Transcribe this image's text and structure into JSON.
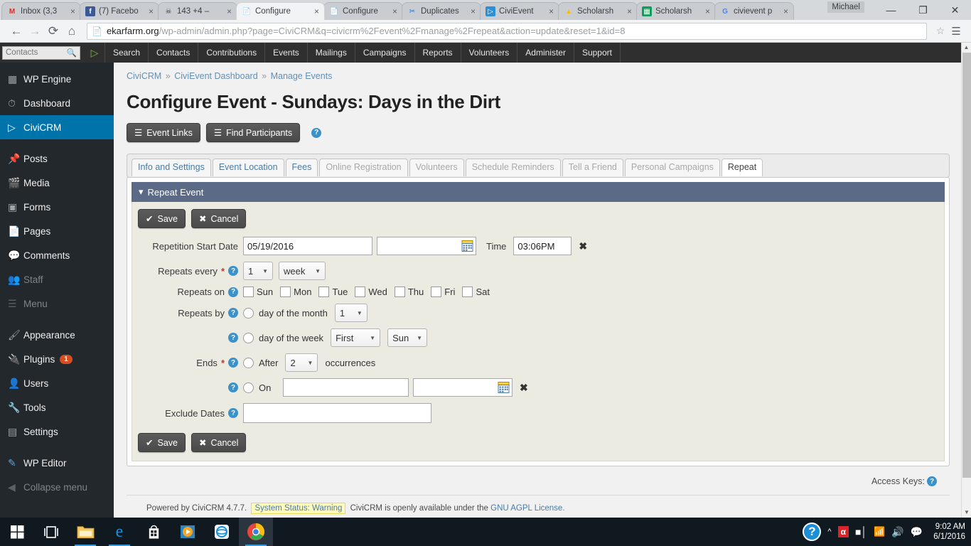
{
  "browser": {
    "tabs": [
      {
        "label": "Inbox (3,3",
        "icon": "gmail-icon",
        "active": false
      },
      {
        "label": "(7) Facebo",
        "icon": "facebook-icon",
        "active": false
      },
      {
        "label": "143 +4 –",
        "icon": "skull-icon",
        "active": false
      },
      {
        "label": "Configure",
        "icon": "page-icon",
        "active": true
      },
      {
        "label": "Configure",
        "icon": "page-icon",
        "active": false
      },
      {
        "label": "Duplicates",
        "icon": "scissors-icon",
        "active": false
      },
      {
        "label": "CiviEvent",
        "icon": "civi-icon",
        "active": false
      },
      {
        "label": "Scholarsh",
        "icon": "gdrive-icon",
        "active": false
      },
      {
        "label": "Scholarsh",
        "icon": "gsheets-icon",
        "active": false
      },
      {
        "label": "civievent p",
        "icon": "google-icon",
        "active": false
      }
    ],
    "close_glyph": "×",
    "user_chip": "Michael",
    "window_controls": {
      "minimize": "—",
      "maximize": "❐",
      "close": "✕"
    },
    "nav": {
      "back": "←",
      "forward": "→",
      "reload": "⟳",
      "home": "⌂"
    },
    "url_host": "ekarfarm.org",
    "url_path": "/wp-admin/admin.php?page=CiviCRM&q=civicrm%2Fevent%2Fmanage%2Frepeat&action=update&reset=1&id=8",
    "star": "☆",
    "menu": "☰"
  },
  "civibar": {
    "search_placeholder": "Contacts",
    "search_icon": "search-icon",
    "logo": "civicrm-logo",
    "items": [
      "Search",
      "Contacts",
      "Contributions",
      "Events",
      "Mailings",
      "Campaigns",
      "Reports",
      "Volunteers",
      "Administer",
      "Support"
    ]
  },
  "sidebar": {
    "items": [
      {
        "label": "WP Engine",
        "icon": "wpengine-icon",
        "state": "normal"
      },
      {
        "label": "Dashboard",
        "icon": "dashboard-icon",
        "state": "normal"
      },
      {
        "label": "CiviCRM",
        "icon": "civicrm-icon",
        "state": "current"
      },
      {
        "label": "Posts",
        "icon": "pin-icon",
        "state": "normal"
      },
      {
        "label": "Media",
        "icon": "media-icon",
        "state": "normal"
      },
      {
        "label": "Forms",
        "icon": "forms-icon",
        "state": "normal"
      },
      {
        "label": "Pages",
        "icon": "pages-icon",
        "state": "normal"
      },
      {
        "label": "Comments",
        "icon": "comment-icon",
        "state": "normal"
      },
      {
        "label": "Staff",
        "icon": "users-icon",
        "state": "dim"
      },
      {
        "label": "Menu",
        "icon": "menu-icon",
        "state": "dim"
      },
      {
        "label": "Appearance",
        "icon": "brush-icon",
        "state": "normal"
      },
      {
        "label": "Plugins",
        "icon": "plug-icon",
        "state": "normal",
        "badge": "1"
      },
      {
        "label": "Users",
        "icon": "user-icon",
        "state": "normal"
      },
      {
        "label": "Tools",
        "icon": "wrench-icon",
        "state": "normal"
      },
      {
        "label": "Settings",
        "icon": "sliders-icon",
        "state": "normal"
      },
      {
        "label": "WP Editor",
        "icon": "pencil-icon",
        "state": "normal"
      },
      {
        "label": "Collapse menu",
        "icon": "collapse-icon",
        "state": "dim"
      }
    ]
  },
  "page": {
    "breadcrumb": [
      {
        "label": "CiviCRM",
        "link": true
      },
      {
        "label": "CiviEvent Dashboard",
        "link": true
      },
      {
        "label": "Manage Events",
        "link": true
      }
    ],
    "breadcrumb_sep": "»",
    "title": "Configure Event - Sundays: Days in the Dirt",
    "actions": [
      {
        "label": "Event Links",
        "icon": "hamburger-icon"
      },
      {
        "label": "Find Participants",
        "icon": "hamburger-icon"
      }
    ],
    "help_glyph": "?",
    "tabs": [
      {
        "label": "Info and Settings",
        "state": "link"
      },
      {
        "label": "Event Location",
        "state": "link"
      },
      {
        "label": "Fees",
        "state": "link"
      },
      {
        "label": "Online Registration",
        "state": "disabled"
      },
      {
        "label": "Volunteers",
        "state": "disabled"
      },
      {
        "label": "Schedule Reminders",
        "state": "disabled"
      },
      {
        "label": "Tell a Friend",
        "state": "disabled"
      },
      {
        "label": "Personal Campaigns",
        "state": "disabled"
      },
      {
        "label": "Repeat",
        "state": "active"
      }
    ],
    "panel": {
      "title": "Repeat Event",
      "collapse_glyph": "▾",
      "save_label": "Save",
      "cancel_label": "Cancel",
      "save_icon": "check-icon",
      "cancel_icon": "x-icon",
      "fields": {
        "start_date_label": "Repetition Start Date",
        "start_date_value": "05/19/2016",
        "start_date_second_value": "",
        "time_label": "Time",
        "time_value": "03:06PM",
        "clear_glyph": "✖",
        "repeats_every_label": "Repeats every",
        "repeats_every_count": "1",
        "repeats_every_unit": "week",
        "repeats_on_label": "Repeats on",
        "days": [
          "Sun",
          "Mon",
          "Tue",
          "Wed",
          "Thu",
          "Fri",
          "Sat"
        ],
        "repeats_by_label": "Repeats by",
        "day_of_month_label": "day of the month",
        "day_of_month_value": "1",
        "day_of_week_label": "day of the week",
        "day_of_week_ordinal": "First",
        "day_of_week_day": "Sun",
        "ends_label": "Ends",
        "after_label": "After",
        "after_count": "2",
        "occurrences_label": "occurrences",
        "on_label": "On",
        "on_date_value": "",
        "on_date_second_value": "",
        "exclude_dates_label": "Exclude Dates",
        "exclude_dates_value": ""
      }
    },
    "access_keys_label": "Access Keys:",
    "footer": {
      "powered": "Powered by CiviCRM 4.7.7.",
      "status": "System Status: Warning",
      "middle": "CiviCRM is openly available under the",
      "license": "GNU AGPL License."
    }
  },
  "taskbar": {
    "icons": [
      "start-icon",
      "taskview-icon",
      "file-explorer-icon",
      "edge-icon",
      "store-icon",
      "media-player-icon",
      "ie-icon",
      "chrome-icon"
    ],
    "tray": [
      "help-icon",
      "chevron-up-icon",
      "antivirus-icon",
      "battery-icon",
      "wifi-icon",
      "volume-icon",
      "notifications-icon"
    ],
    "time": "9:02 AM",
    "date": "6/1/2016"
  },
  "colors": {
    "wp_sidebar": "#23282d",
    "wp_current": "#0073aa",
    "panel_head": "#5b6a87",
    "panel_body": "#ecebe1",
    "link": "#4a7ba6",
    "badge": "#d54e21"
  }
}
